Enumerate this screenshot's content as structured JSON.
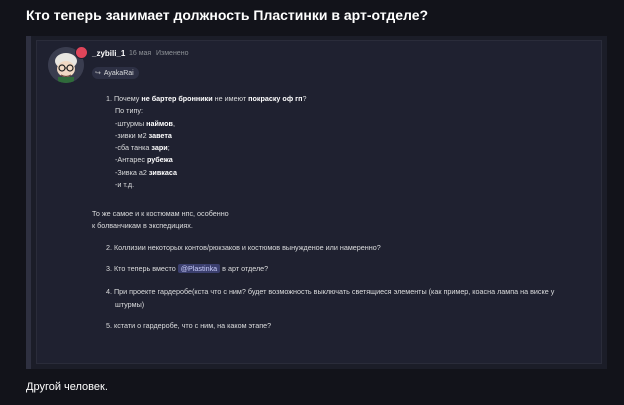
{
  "page": {
    "title": "Кто теперь занимает должность Пластинки в арт-отделе?",
    "footer_text": "Другой человек."
  },
  "message": {
    "username": "_zybili_1",
    "date": "16 мая",
    "edited": "Изменено",
    "reply_to": "AyakaRai",
    "q1": {
      "num": "1.",
      "pre": "Почему ",
      "b1": "не бартер бронники",
      "mid": " не имеют ",
      "b2": "покраску оф гп",
      "post": "?"
    },
    "po_tipu": "По типу:",
    "list": [
      {
        "pre": "-штурмы ",
        "bold": "наймов",
        "post": ","
      },
      {
        "pre": "-зивки м2 ",
        "bold": "завета",
        "post": ""
      },
      {
        "pre": "-сба танка ",
        "bold": "зари",
        "post": ";"
      },
      {
        "pre": "-Антарес ",
        "bold": "рубежа",
        "post": ""
      },
      {
        "pre": "-Зивка а2 ",
        "bold": "зивкаса",
        "post": ""
      },
      {
        "pre": "-и т.д.",
        "bold": "",
        "post": ""
      }
    ],
    "para1": "То же самое и к костюмам нпс, особенно",
    "para2": "к болванчикам в экспедициях.",
    "q2": "2. Коллизии некоторых контов/рюкзаков и костюмов вынужденое или намеренно?",
    "q3_pre": "3. Кто теперь вместо ",
    "q3_mention": "@Plastinka",
    "q3_post": " в арт отделе?",
    "q4_line1": "4. При проекте гардеробе(кста что с ним? будет возможность выключать светящиеся элементы (как пример, коасна лампа на виске у",
    "q4_line2": "штурмы)",
    "q5": "5. кстати о гардеробе, что с ним, на каком этапе?"
  },
  "colors": {
    "background": "#12131a",
    "quote_box": "#1b1d28",
    "message_bg": "#1f2130",
    "mention_bg": "#3b3f6e",
    "avatar_badge": "#e0455a"
  }
}
